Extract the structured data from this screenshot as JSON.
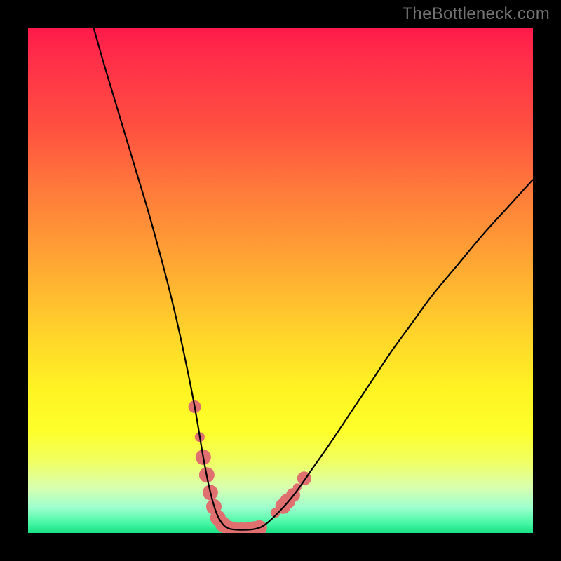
{
  "watermark": "TheBottleneck.com",
  "chart_data": {
    "type": "line",
    "title": "",
    "xlabel": "",
    "ylabel": "",
    "xlim": [
      0,
      100
    ],
    "ylim": [
      0,
      100
    ],
    "grid": false,
    "series": [
      {
        "name": "curve",
        "color": "#000000",
        "x": [
          13,
          15,
          18,
          21,
          24,
          27,
          29,
          31,
          33,
          34.7,
          36,
          37.3,
          38.6,
          40,
          42.5,
          45,
          47,
          50,
          53,
          56.5,
          60,
          64,
          68,
          72,
          76,
          80,
          85,
          90,
          95,
          100
        ],
        "values": [
          100,
          93,
          83,
          73,
          63,
          52,
          44,
          35,
          25,
          15,
          8.5,
          4,
          1.7,
          0.8,
          0.6,
          0.8,
          1.7,
          4.5,
          8,
          13,
          18,
          24,
          30,
          36,
          41.5,
          47,
          53,
          59,
          64.5,
          70
        ]
      }
    ],
    "markers": [
      {
        "name": "threshold-dot",
        "x": 33.0,
        "y": 25.0,
        "r": 9,
        "color": "#e07070"
      },
      {
        "name": "threshold-dot",
        "x": 34.0,
        "y": 19.0,
        "r": 7,
        "color": "#e07070"
      },
      {
        "name": "threshold-dot",
        "x": 34.7,
        "y": 15.0,
        "r": 11,
        "color": "#e07070"
      },
      {
        "name": "threshold-dot",
        "x": 35.4,
        "y": 11.5,
        "r": 11,
        "color": "#e07070"
      },
      {
        "name": "threshold-dot",
        "x": 36.1,
        "y": 8.0,
        "r": 11,
        "color": "#e07070"
      },
      {
        "name": "threshold-dot",
        "x": 36.8,
        "y": 5.2,
        "r": 11,
        "color": "#e07070"
      },
      {
        "name": "threshold-dot",
        "x": 37.6,
        "y": 3.0,
        "r": 11,
        "color": "#e07070"
      },
      {
        "name": "threshold-dot",
        "x": 38.6,
        "y": 1.7,
        "r": 11,
        "color": "#e07070"
      },
      {
        "name": "threshold-dot",
        "x": 39.8,
        "y": 0.9,
        "r": 11,
        "color": "#e07070"
      },
      {
        "name": "threshold-dot",
        "x": 41.0,
        "y": 0.6,
        "r": 11,
        "color": "#e07070"
      },
      {
        "name": "threshold-dot",
        "x": 42.3,
        "y": 0.6,
        "r": 11,
        "color": "#e07070"
      },
      {
        "name": "threshold-dot",
        "x": 43.5,
        "y": 0.6,
        "r": 11,
        "color": "#e07070"
      },
      {
        "name": "threshold-dot",
        "x": 44.8,
        "y": 0.8,
        "r": 11,
        "color": "#e07070"
      },
      {
        "name": "threshold-dot",
        "x": 45.8,
        "y": 1.0,
        "r": 11,
        "color": "#e07070"
      },
      {
        "name": "threshold-dot",
        "x": 49.0,
        "y": 4.0,
        "r": 7,
        "color": "#e07070"
      },
      {
        "name": "threshold-dot",
        "x": 50.5,
        "y": 5.3,
        "r": 11,
        "color": "#e07070"
      },
      {
        "name": "threshold-dot",
        "x": 51.4,
        "y": 6.3,
        "r": 11,
        "color": "#e07070"
      },
      {
        "name": "threshold-dot",
        "x": 52.5,
        "y": 7.5,
        "r": 10,
        "color": "#e07070"
      },
      {
        "name": "threshold-dot",
        "x": 53.3,
        "y": 9.0,
        "r": 6,
        "color": "#e07070"
      },
      {
        "name": "threshold-dot",
        "x": 54.7,
        "y": 10.8,
        "r": 10,
        "color": "#e07070"
      }
    ],
    "gradient_stops": [
      {
        "pos": 0,
        "hex": "#ff1a49"
      },
      {
        "pos": 6,
        "hex": "#ff2e49"
      },
      {
        "pos": 20,
        "hex": "#ff5140"
      },
      {
        "pos": 32,
        "hex": "#ff7a3b"
      },
      {
        "pos": 46,
        "hex": "#ffa534"
      },
      {
        "pos": 60,
        "hex": "#ffd22b"
      },
      {
        "pos": 72,
        "hex": "#fff423"
      },
      {
        "pos": 80,
        "hex": "#fdff2b"
      },
      {
        "pos": 86,
        "hex": "#f0ff64"
      },
      {
        "pos": 91,
        "hex": "#d9ffb0"
      },
      {
        "pos": 95,
        "hex": "#9cffce"
      },
      {
        "pos": 98,
        "hex": "#49f7a5"
      },
      {
        "pos": 100,
        "hex": "#17e186"
      }
    ]
  }
}
